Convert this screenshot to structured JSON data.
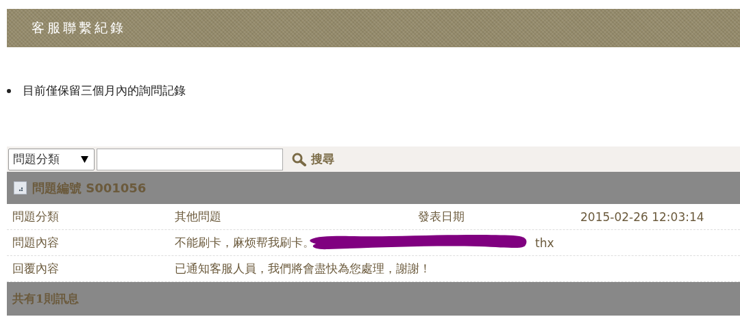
{
  "header": {
    "title": "客服聯繫紀錄"
  },
  "notes": [
    "目前僅保留三個月內的詢問記錄"
  ],
  "search": {
    "category": "問題分類",
    "button": "搜尋"
  },
  "ticket": {
    "title": "問題編號 S001056",
    "rows": [
      {
        "cells": [
          {
            "kind": "label",
            "segments": [
              {
                "kind": "text",
                "text": "問題分類"
              }
            ]
          },
          {
            "kind": "value",
            "segments": [
              {
                "kind": "text",
                "text": "其他問題"
              }
            ]
          },
          {
            "kind": "label",
            "segments": [
              {
                "kind": "text",
                "text": "發表日期"
              }
            ]
          },
          {
            "kind": "date",
            "segments": [
              {
                "kind": "text",
                "text": "2015-02-26 12:03:14"
              }
            ]
          }
        ]
      },
      {
        "cells": [
          {
            "kind": "label",
            "segments": [
              {
                "kind": "text",
                "text": "問題內容"
              }
            ]
          },
          {
            "kind": "wide",
            "segments": [
              {
                "kind": "text",
                "text": "不能刷卡，麻烦帮我刷卡。"
              },
              {
                "kind": "redaction"
              },
              {
                "kind": "latin",
                "text": "thx"
              }
            ]
          }
        ]
      },
      {
        "cells": [
          {
            "kind": "label",
            "segments": [
              {
                "kind": "text",
                "text": "回覆內容"
              }
            ]
          },
          {
            "kind": "wide",
            "segments": [
              {
                "kind": "text",
                "text": "已通知客服人員，我們將會盡快為您處理，謝謝！"
              }
            ]
          }
        ]
      }
    ],
    "footer": "共有1則訊息"
  }
}
